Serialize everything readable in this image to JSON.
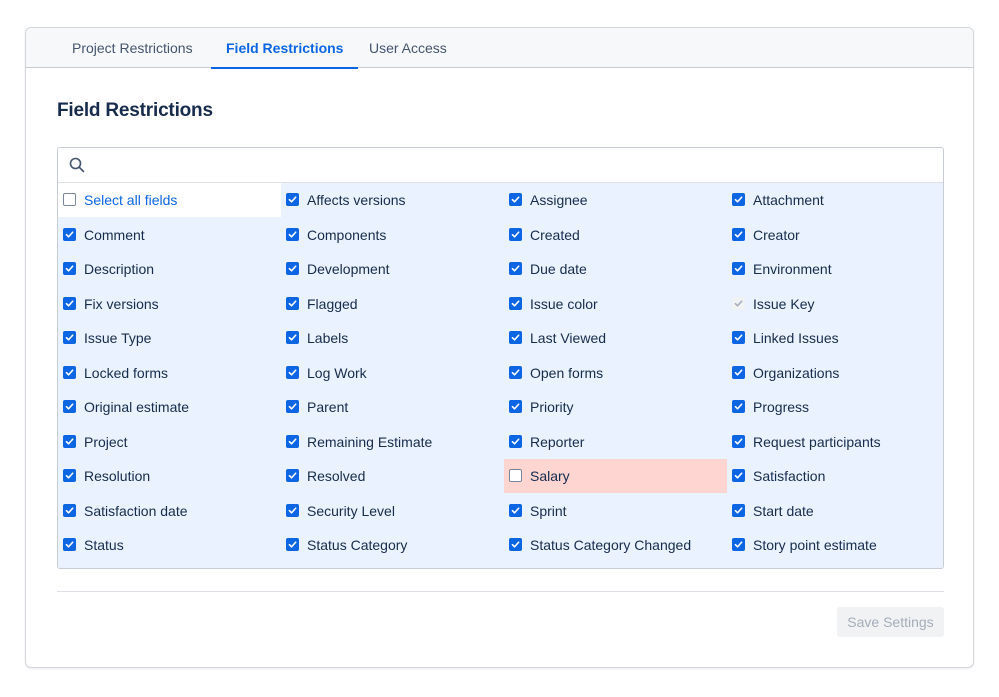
{
  "tabs": {
    "project": "Project Restrictions",
    "field": "Field Restrictions",
    "user": "User Access"
  },
  "page_title": "Field Restrictions",
  "search": {
    "placeholder": "",
    "value": ""
  },
  "colors": {
    "accent": "#0c66e4",
    "grid_background": "#e9f2fe",
    "warning_background": "#ffd5d2"
  },
  "fields": [
    [
      "Select all fields",
      "Affects versions",
      "Assignee",
      "Attachment"
    ],
    [
      "Comment",
      "Components",
      "Created",
      "Creator"
    ],
    [
      "Description",
      "Development",
      "Due date",
      "Environment"
    ],
    [
      "Fix versions",
      "Flagged",
      "Issue color",
      "Issue Key"
    ],
    [
      "Issue Type",
      "Labels",
      "Last Viewed",
      "Linked Issues"
    ],
    [
      "Locked forms",
      "Log Work",
      "Open forms",
      "Organizations"
    ],
    [
      "Original estimate",
      "Parent",
      "Priority",
      "Progress"
    ],
    [
      "Project",
      "Remaining Estimate",
      "Reporter",
      "Request participants"
    ],
    [
      "Resolution",
      "Resolved",
      "Salary",
      "Satisfaction"
    ],
    [
      "Satisfaction date",
      "Security Level",
      "Sprint",
      "Start date"
    ],
    [
      "Status",
      "Status Category",
      "Status Category Changed",
      "Story point estimate"
    ]
  ],
  "field_states": {
    "select_all": "unchecked",
    "issue_key": "checked-disabled",
    "salary": "unchecked-highlighted",
    "default": "checked"
  },
  "save_button": {
    "label": "Save Settings",
    "enabled": false
  }
}
